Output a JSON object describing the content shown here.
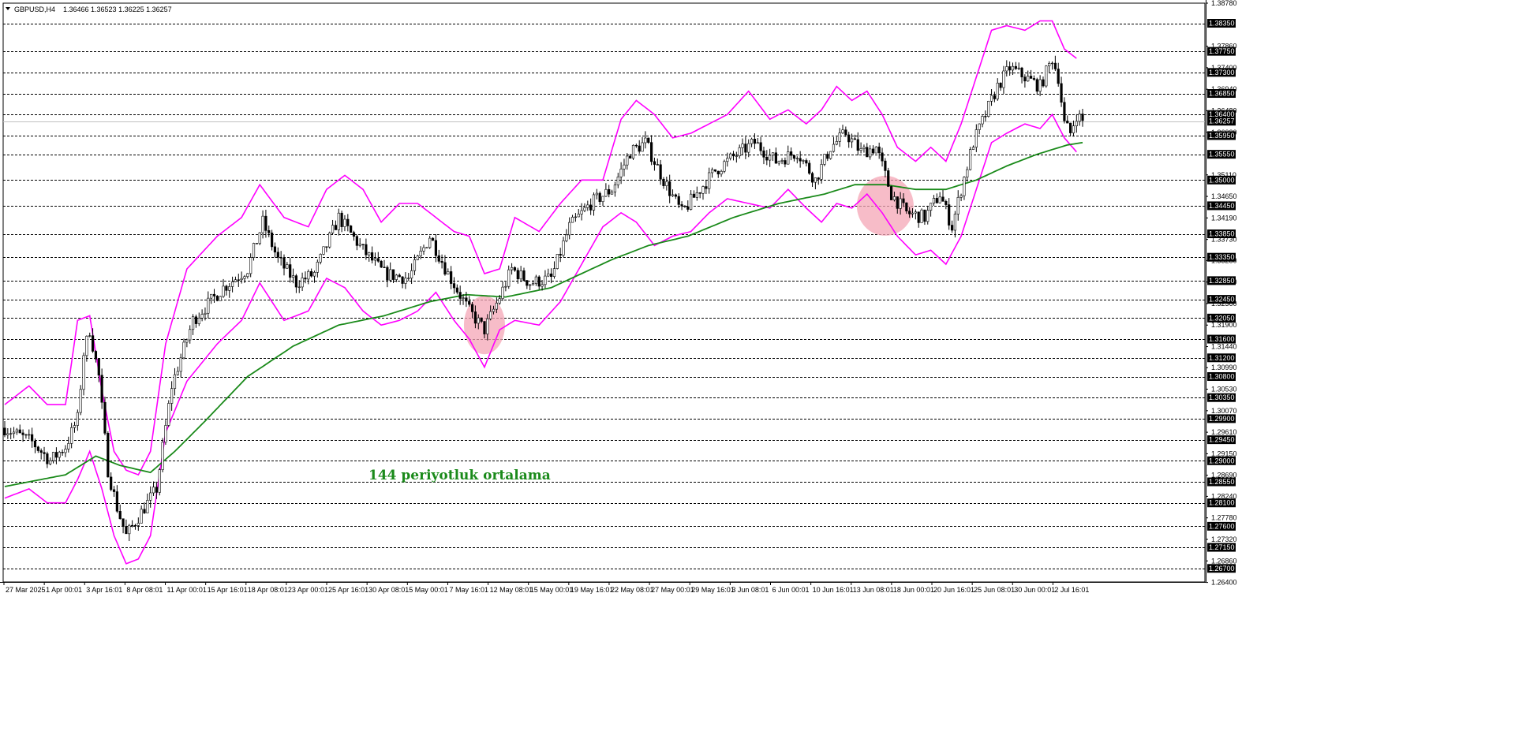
{
  "header": {
    "symbol": "GBPUSD,H4",
    "ohlc": "1.36466 1.36523 1.36225 1.36257",
    "menu_icon": "triangle-down-icon"
  },
  "colors": {
    "background": "#ffffff",
    "bull_candle": "#ffffff",
    "bear_candle": "#000000",
    "bollinger": "#ff00ff",
    "moving_average": "#1a8a1a",
    "highlight": "#f4a6b5",
    "grid": "#000000"
  },
  "chart_data": {
    "type": "line",
    "title": "",
    "symbol": "GBPUSD",
    "timeframe": "H4",
    "ylim": [
      1.2641,
      1.3878
    ],
    "current_price": "1.36257",
    "x_tick_labels": [
      "27 Mar 2025",
      "1 Apr 00:01",
      "3 Apr 16:01",
      "8 Apr 08:01",
      "11 Apr 00:01",
      "15 Apr 16:01",
      "18 Apr 08:01",
      "23 Apr 00:01",
      "25 Apr 16:01",
      "30 Apr 08:01",
      "5 May 00:01",
      "7 May 16:01",
      "12 May 08:01",
      "15 May 00:01",
      "19 May 16:01",
      "22 May 08:01",
      "27 May 00:01",
      "29 May 16:01",
      "3 Jun 08:01",
      "6 Jun 00:01",
      "10 Jun 16:01",
      "13 Jun 08:01",
      "18 Jun 00:01",
      "20 Jun 16:01",
      "25 Jun 08:01",
      "30 Jun 00:01",
      "2 Jul 16:01"
    ],
    "y_tick_labels": [
      "1.38780",
      "1.37860",
      "1.37400",
      "1.36940",
      "1.36480",
      "1.36020",
      "1.35110",
      "1.34650",
      "1.34190",
      "1.33730",
      "1.33280",
      "1.32820",
      "1.32360",
      "1.31900",
      "1.31440",
      "1.30990",
      "1.30530",
      "1.30070",
      "1.29610",
      "1.29150",
      "1.28690",
      "1.28240",
      "1.27780",
      "1.27320",
      "1.26860",
      "1.26400"
    ],
    "levels": [
      "1.38350",
      "1.37750",
      "1.37300",
      "1.36850",
      "1.36400",
      "1.35950",
      "1.35550",
      "1.35000",
      "1.34450",
      "1.33850",
      "1.33350",
      "1.32850",
      "1.32450",
      "1.32050",
      "1.31600",
      "1.31200",
      "1.30800",
      "1.30350",
      "1.29900",
      "1.29450",
      "1.29000",
      "1.28550",
      "1.28100",
      "1.27600",
      "1.27150",
      "1.26700"
    ],
    "key_prices": [
      {
        "t": 0,
        "p": 1.297
      },
      {
        "t": 9,
        "p": 1.294
      },
      {
        "t": 15,
        "p": 1.29
      },
      {
        "t": 20,
        "p": 1.293
      },
      {
        "t": 24,
        "p": 1.299
      },
      {
        "t": 26,
        "p": 1.313
      },
      {
        "t": 28,
        "p": 1.318
      },
      {
        "t": 31,
        "p": 1.308
      },
      {
        "t": 34,
        "p": 1.288
      },
      {
        "t": 37,
        "p": 1.28
      },
      {
        "t": 40,
        "p": 1.274
      },
      {
        "t": 45,
        "p": 1.279
      },
      {
        "t": 50,
        "p": 1.284
      },
      {
        "t": 55,
        "p": 1.306
      },
      {
        "t": 62,
        "p": 1.32
      },
      {
        "t": 72,
        "p": 1.327
      },
      {
        "t": 80,
        "p": 1.331
      },
      {
        "t": 85,
        "p": 1.341
      },
      {
        "t": 90,
        "p": 1.333
      },
      {
        "t": 96,
        "p": 1.328
      },
      {
        "t": 102,
        "p": 1.33
      },
      {
        "t": 110,
        "p": 1.342
      },
      {
        "t": 118,
        "p": 1.335
      },
      {
        "t": 125,
        "p": 1.33
      },
      {
        "t": 133,
        "p": 1.329
      },
      {
        "t": 140,
        "p": 1.338
      },
      {
        "t": 146,
        "p": 1.33
      },
      {
        "t": 153,
        "p": 1.322
      },
      {
        "t": 158,
        "p": 1.318
      },
      {
        "t": 163,
        "p": 1.325
      },
      {
        "t": 167,
        "p": 1.331
      },
      {
        "t": 173,
        "p": 1.328
      },
      {
        "t": 180,
        "p": 1.329
      },
      {
        "t": 186,
        "p": 1.34
      },
      {
        "t": 193,
        "p": 1.345
      },
      {
        "t": 200,
        "p": 1.348
      },
      {
        "t": 206,
        "p": 1.356
      },
      {
        "t": 211,
        "p": 1.358
      },
      {
        "t": 217,
        "p": 1.35
      },
      {
        "t": 223,
        "p": 1.343
      },
      {
        "t": 229,
        "p": 1.348
      },
      {
        "t": 234,
        "p": 1.352
      },
      {
        "t": 240,
        "p": 1.355
      },
      {
        "t": 247,
        "p": 1.358
      },
      {
        "t": 254,
        "p": 1.354
      },
      {
        "t": 261,
        "p": 1.356
      },
      {
        "t": 267,
        "p": 1.35
      },
      {
        "t": 272,
        "p": 1.357
      },
      {
        "t": 277,
        "p": 1.36
      },
      {
        "t": 282,
        "p": 1.356
      },
      {
        "t": 287,
        "p": 1.357
      },
      {
        "t": 292,
        "p": 1.347
      },
      {
        "t": 297,
        "p": 1.343
      },
      {
        "t": 303,
        "p": 1.342
      },
      {
        "t": 308,
        "p": 1.347
      },
      {
        "t": 312,
        "p": 1.34
      },
      {
        "t": 315,
        "p": 1.348
      },
      {
        "t": 319,
        "p": 1.358
      },
      {
        "t": 323,
        "p": 1.364
      },
      {
        "t": 327,
        "p": 1.37
      },
      {
        "t": 331,
        "p": 1.374
      },
      {
        "t": 336,
        "p": 1.372
      },
      {
        "t": 341,
        "p": 1.37
      },
      {
        "t": 345,
        "p": 1.376
      },
      {
        "t": 347,
        "p": 1.372
      },
      {
        "t": 349,
        "p": 1.362
      },
      {
        "t": 351,
        "p": 1.36
      },
      {
        "t": 353,
        "p": 1.364
      },
      {
        "t": 355,
        "p": 1.3626
      }
    ],
    "moving_average": {
      "label": "144 periyotluk ortalama",
      "points": [
        {
          "t": 0,
          "p": 1.2845
        },
        {
          "t": 20,
          "p": 1.287
        },
        {
          "t": 30,
          "p": 1.291
        },
        {
          "t": 38,
          "p": 1.289
        },
        {
          "t": 48,
          "p": 1.2875
        },
        {
          "t": 56,
          "p": 1.292
        },
        {
          "t": 66,
          "p": 1.2985
        },
        {
          "t": 80,
          "p": 1.308
        },
        {
          "t": 95,
          "p": 1.3145
        },
        {
          "t": 110,
          "p": 1.319
        },
        {
          "t": 125,
          "p": 1.321
        },
        {
          "t": 140,
          "p": 1.324
        },
        {
          "t": 152,
          "p": 1.3255
        },
        {
          "t": 165,
          "p": 1.325
        },
        {
          "t": 180,
          "p": 1.327
        },
        {
          "t": 190,
          "p": 1.33
        },
        {
          "t": 200,
          "p": 1.333
        },
        {
          "t": 212,
          "p": 1.336
        },
        {
          "t": 225,
          "p": 1.338
        },
        {
          "t": 240,
          "p": 1.342
        },
        {
          "t": 255,
          "p": 1.345
        },
        {
          "t": 270,
          "p": 1.347
        },
        {
          "t": 280,
          "p": 1.349
        },
        {
          "t": 290,
          "p": 1.349
        },
        {
          "t": 300,
          "p": 1.348
        },
        {
          "t": 310,
          "p": 1.348
        },
        {
          "t": 320,
          "p": 1.35
        },
        {
          "t": 330,
          "p": 1.353
        },
        {
          "t": 340,
          "p": 1.3555
        },
        {
          "t": 350,
          "p": 1.3575
        },
        {
          "t": 355,
          "p": 1.358
        }
      ]
    },
    "bollinger_upper": [
      {
        "t": 0,
        "p": 1.302
      },
      {
        "t": 8,
        "p": 1.306
      },
      {
        "t": 14,
        "p": 1.302
      },
      {
        "t": 20,
        "p": 1.302
      },
      {
        "t": 24,
        "p": 1.32
      },
      {
        "t": 28,
        "p": 1.321
      },
      {
        "t": 32,
        "p": 1.305
      },
      {
        "t": 36,
        "p": 1.292
      },
      {
        "t": 40,
        "p": 1.288
      },
      {
        "t": 44,
        "p": 1.287
      },
      {
        "t": 48,
        "p": 1.292
      },
      {
        "t": 53,
        "p": 1.315
      },
      {
        "t": 60,
        "p": 1.331
      },
      {
        "t": 70,
        "p": 1.338
      },
      {
        "t": 78,
        "p": 1.342
      },
      {
        "t": 84,
        "p": 1.349
      },
      {
        "t": 92,
        "p": 1.342
      },
      {
        "t": 100,
        "p": 1.34
      },
      {
        "t": 106,
        "p": 1.348
      },
      {
        "t": 112,
        "p": 1.351
      },
      {
        "t": 118,
        "p": 1.348
      },
      {
        "t": 124,
        "p": 1.341
      },
      {
        "t": 130,
        "p": 1.345
      },
      {
        "t": 136,
        "p": 1.345
      },
      {
        "t": 142,
        "p": 1.342
      },
      {
        "t": 148,
        "p": 1.339
      },
      {
        "t": 153,
        "p": 1.338
      },
      {
        "t": 158,
        "p": 1.33
      },
      {
        "t": 163,
        "p": 1.331
      },
      {
        "t": 168,
        "p": 1.342
      },
      {
        "t": 176,
        "p": 1.339
      },
      {
        "t": 183,
        "p": 1.345
      },
      {
        "t": 190,
        "p": 1.35
      },
      {
        "t": 197,
        "p": 1.35
      },
      {
        "t": 203,
        "p": 1.363
      },
      {
        "t": 208,
        "p": 1.367
      },
      {
        "t": 214,
        "p": 1.364
      },
      {
        "t": 220,
        "p": 1.359
      },
      {
        "t": 226,
        "p": 1.36
      },
      {
        "t": 232,
        "p": 1.362
      },
      {
        "t": 238,
        "p": 1.364
      },
      {
        "t": 245,
        "p": 1.369
      },
      {
        "t": 252,
        "p": 1.363
      },
      {
        "t": 258,
        "p": 1.365
      },
      {
        "t": 264,
        "p": 1.362
      },
      {
        "t": 269,
        "p": 1.365
      },
      {
        "t": 274,
        "p": 1.37
      },
      {
        "t": 279,
        "p": 1.367
      },
      {
        "t": 284,
        "p": 1.369
      },
      {
        "t": 289,
        "p": 1.364
      },
      {
        "t": 294,
        "p": 1.357
      },
      {
        "t": 300,
        "p": 1.354
      },
      {
        "t": 305,
        "p": 1.357
      },
      {
        "t": 310,
        "p": 1.354
      },
      {
        "t": 315,
        "p": 1.362
      },
      {
        "t": 320,
        "p": 1.372
      },
      {
        "t": 325,
        "p": 1.382
      },
      {
        "t": 330,
        "p": 1.383
      },
      {
        "t": 336,
        "p": 1.382
      },
      {
        "t": 341,
        "p": 1.384
      },
      {
        "t": 345,
        "p": 1.384
      },
      {
        "t": 349,
        "p": 1.378
      },
      {
        "t": 353,
        "p": 1.376
      }
    ],
    "bollinger_lower": [
      {
        "t": 0,
        "p": 1.282
      },
      {
        "t": 8,
        "p": 1.284
      },
      {
        "t": 14,
        "p": 1.281
      },
      {
        "t": 20,
        "p": 1.281
      },
      {
        "t": 24,
        "p": 1.286
      },
      {
        "t": 28,
        "p": 1.292
      },
      {
        "t": 32,
        "p": 1.284
      },
      {
        "t": 36,
        "p": 1.274
      },
      {
        "t": 40,
        "p": 1.268
      },
      {
        "t": 44,
        "p": 1.269
      },
      {
        "t": 48,
        "p": 1.274
      },
      {
        "t": 53,
        "p": 1.296
      },
      {
        "t": 60,
        "p": 1.307
      },
      {
        "t": 70,
        "p": 1.315
      },
      {
        "t": 78,
        "p": 1.32
      },
      {
        "t": 84,
        "p": 1.328
      },
      {
        "t": 92,
        "p": 1.32
      },
      {
        "t": 100,
        "p": 1.322
      },
      {
        "t": 106,
        "p": 1.329
      },
      {
        "t": 112,
        "p": 1.327
      },
      {
        "t": 118,
        "p": 1.322
      },
      {
        "t": 124,
        "p": 1.319
      },
      {
        "t": 130,
        "p": 1.32
      },
      {
        "t": 136,
        "p": 1.322
      },
      {
        "t": 142,
        "p": 1.326
      },
      {
        "t": 148,
        "p": 1.32
      },
      {
        "t": 153,
        "p": 1.316
      },
      {
        "t": 158,
        "p": 1.31
      },
      {
        "t": 163,
        "p": 1.318
      },
      {
        "t": 168,
        "p": 1.32
      },
      {
        "t": 176,
        "p": 1.319
      },
      {
        "t": 183,
        "p": 1.324
      },
      {
        "t": 190,
        "p": 1.332
      },
      {
        "t": 197,
        "p": 1.34
      },
      {
        "t": 203,
        "p": 1.343
      },
      {
        "t": 208,
        "p": 1.341
      },
      {
        "t": 214,
        "p": 1.336
      },
      {
        "t": 220,
        "p": 1.338
      },
      {
        "t": 226,
        "p": 1.339
      },
      {
        "t": 232,
        "p": 1.343
      },
      {
        "t": 238,
        "p": 1.346
      },
      {
        "t": 245,
        "p": 1.345
      },
      {
        "t": 252,
        "p": 1.344
      },
      {
        "t": 258,
        "p": 1.348
      },
      {
        "t": 264,
        "p": 1.344
      },
      {
        "t": 269,
        "p": 1.341
      },
      {
        "t": 274,
        "p": 1.345
      },
      {
        "t": 279,
        "p": 1.344
      },
      {
        "t": 284,
        "p": 1.347
      },
      {
        "t": 289,
        "p": 1.343
      },
      {
        "t": 294,
        "p": 1.338
      },
      {
        "t": 300,
        "p": 1.334
      },
      {
        "t": 305,
        "p": 1.335
      },
      {
        "t": 310,
        "p": 1.332
      },
      {
        "t": 315,
        "p": 1.338
      },
      {
        "t": 320,
        "p": 1.348
      },
      {
        "t": 325,
        "p": 1.358
      },
      {
        "t": 330,
        "p": 1.36
      },
      {
        "t": 336,
        "p": 1.362
      },
      {
        "t": 341,
        "p": 1.361
      },
      {
        "t": 345,
        "p": 1.364
      },
      {
        "t": 349,
        "p": 1.359
      },
      {
        "t": 353,
        "p": 1.356
      }
    ],
    "highlights": [
      {
        "t": 158,
        "p": 1.319
      },
      {
        "t": 290,
        "p": 1.3445
      }
    ],
    "bar_count": 356
  }
}
